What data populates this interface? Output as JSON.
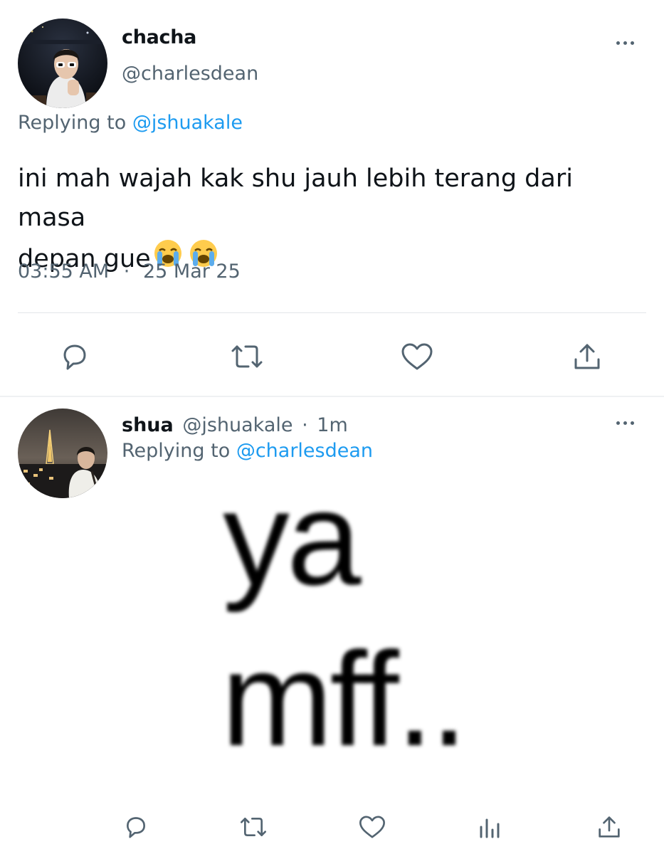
{
  "tweet": {
    "name": "chacha",
    "handle": "@charlesdean",
    "replying_prefix": "Replying to",
    "replying_handle": "@jshuakale",
    "text_line1": "ini mah wajah kak shu jauh lebih terang dari masa",
    "text_line2": "depan gue",
    "emojis": [
      "loudly-crying-face",
      "loudly-crying-face"
    ],
    "time": "03:55 AM",
    "dot": "·",
    "date": "25 Mar 25",
    "actions": [
      "reply-icon",
      "retweet-icon",
      "like-icon",
      "share-icon"
    ]
  },
  "reply": {
    "name": "shua",
    "handle": "@jshuakale",
    "dot": "·",
    "age": "1m",
    "replying_prefix": "Replying to",
    "replying_handle": "@charlesdean",
    "image_text_line1": "ya",
    "image_text_line2": "mff..",
    "actions": [
      "reply-icon",
      "retweet-icon",
      "like-icon",
      "analytics-icon",
      "share-icon"
    ]
  },
  "colors": {
    "text": "#0f1419",
    "secondary": "#536471",
    "link": "#1d9bf0",
    "divider": "#e3e6e9"
  }
}
